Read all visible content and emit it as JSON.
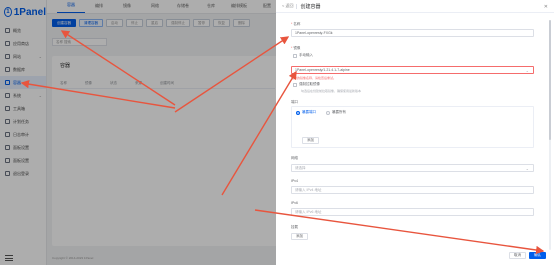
{
  "app": {
    "logo_text": "1Panel"
  },
  "sidebar": {
    "items": [
      {
        "label": "概览",
        "icon": "home-icon"
      },
      {
        "label": "应用商店",
        "icon": "store-icon"
      },
      {
        "label": "网站",
        "icon": "globe-icon",
        "has_children": true
      },
      {
        "label": "数据库",
        "icon": "database-icon"
      },
      {
        "label": "容器",
        "icon": "container-icon",
        "active": true
      },
      {
        "label": "系统",
        "icon": "system-icon",
        "has_children": true
      },
      {
        "label": "工具箱",
        "icon": "toolbox-icon"
      },
      {
        "label": "计划任务",
        "icon": "calendar-icon"
      },
      {
        "label": "日志审计",
        "icon": "log-icon"
      },
      {
        "label": "面板设置",
        "icon": "gear-icon"
      },
      {
        "label": "面板设置",
        "icon": "settings-icon"
      },
      {
        "label": "退出登录",
        "icon": "logout-icon"
      }
    ]
  },
  "topbar": {
    "tabs": [
      "容器",
      "编排",
      "镜像",
      "网络",
      "存储卷",
      "仓库",
      "编排模板",
      "配置"
    ],
    "active_index": 0
  },
  "toolbar": {
    "buttons": [
      "创建容器",
      "清理容器",
      "启动",
      "停止",
      "重启",
      "强制停止",
      "暂停",
      "恢复",
      "删除"
    ]
  },
  "filter": {
    "placeholder": "名称 搜索"
  },
  "container_panel": {
    "title": "容器",
    "columns": [
      "名称",
      "镜像",
      "状态",
      "来源",
      "创建时间"
    ]
  },
  "footer_text": "Copyright © 2014-2023 1Panel",
  "drawer": {
    "back_label": "< 返回",
    "title": "创建容器",
    "name_label": "名称",
    "name_value": "1Panel-openresty-FXGk",
    "image_label": "镜像",
    "manual_label": "手动输入",
    "image_value": "1Panel-openresty/1.21.4.1-7-alpine",
    "image_error": "无效的镜像名称，请检查后重试。",
    "pull_label": "强制拉取镜像",
    "pull_hint": "勾选后在创建前拉取镜像，确保使用最新版本",
    "port_label": "端口",
    "port_options": [
      "暴露端口",
      "暴露所有"
    ],
    "port_selected": 0,
    "add_label": "添加",
    "network_label": "网络",
    "network_placeholder": "请选择",
    "ipv4_label": "IPv4",
    "ipv4_placeholder": "请输入 IPv4 地址",
    "ipv6_label": "IPv6",
    "ipv6_placeholder": "请输入 IPv6 地址",
    "mount_label": "挂载",
    "mount_add_label": "添加",
    "cancel_label": "取消",
    "confirm_label": "确认"
  },
  "colors": {
    "brand": "#005eeb",
    "annotation_arrow": "#e8553e",
    "error": "#f56c6c"
  }
}
